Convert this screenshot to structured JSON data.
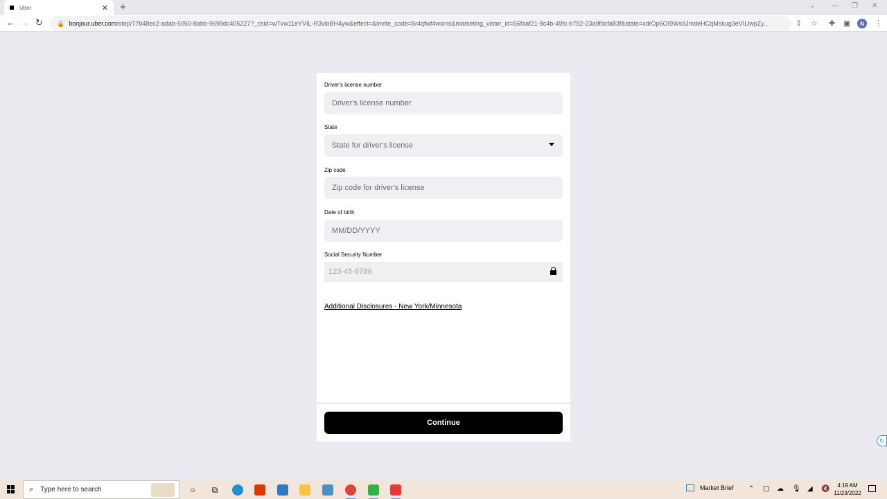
{
  "browser": {
    "tab_title": "Uber",
    "tab_close": "✕",
    "new_tab": "+",
    "url_host": "bonjour.uber.com",
    "url_path": "/step/77b48ec2-adab-5050-8abb-9699dc405227?_csid=wTvw11eYVIL-R3vloBH4yw&effect=&invite_code=5r4qfwf4wxms&marketing_vistor_id=56faaf21-8c4b-49fc-b792-23a9fdcfa83f&state=xdrOp6OI9Ws9JmdeHCqMskug3eVILlwpZy...",
    "profile_initial": "N"
  },
  "form": {
    "license": {
      "label": "Driver's license number",
      "placeholder": "Driver's license number"
    },
    "state": {
      "label": "State",
      "placeholder": "State for driver's license"
    },
    "zip": {
      "label": "Zip code",
      "placeholder": "Zip code for driver's license"
    },
    "dob": {
      "label": "Date of birth",
      "placeholder": "MM/DD/YYYY"
    },
    "ssn": {
      "label": "Social Security Number",
      "placeholder": "123-45-6789"
    },
    "disclosure_link": "Additional Disclosures - New York/Minnesota",
    "continue_label": "Continue"
  },
  "taskbar": {
    "search_placeholder": "Type here to search",
    "market_brief": "Market Brief",
    "time": "4:19 AM",
    "date": "11/23/2022"
  },
  "colors": {
    "accent": "#000000",
    "field_bg": "#f0eff3",
    "page_bg": "#eceaf0"
  }
}
